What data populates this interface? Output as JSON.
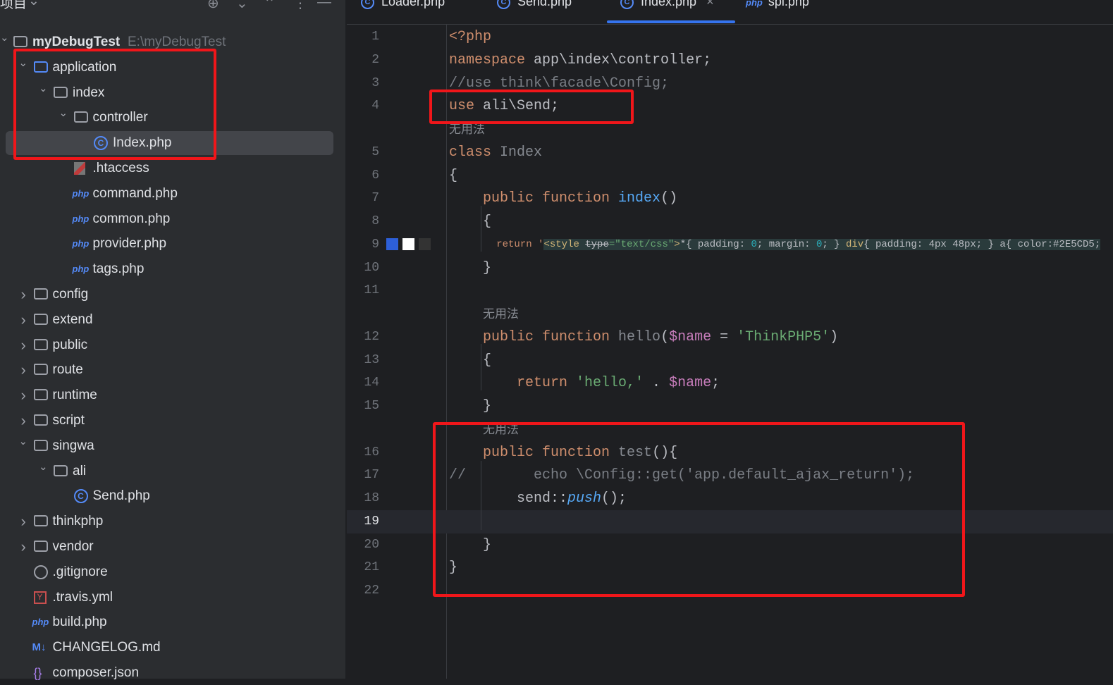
{
  "sidebar": {
    "title": "项目",
    "tree": [
      {
        "label": "myDebugTest",
        "path": "E:\\myDebugTest",
        "icon": "folder",
        "depth": 0,
        "expanded": true,
        "bold": true
      },
      {
        "label": "application",
        "icon": "folder-blue",
        "depth": 1,
        "expanded": true
      },
      {
        "label": "index",
        "icon": "folder",
        "depth": 2,
        "expanded": true
      },
      {
        "label": "controller",
        "icon": "folder",
        "depth": 3,
        "expanded": true
      },
      {
        "label": "Index.php",
        "icon": "class",
        "depth": 4,
        "selected": true
      },
      {
        "label": ".htaccess",
        "icon": "htaccess",
        "depth": 3
      },
      {
        "label": "command.php",
        "icon": "php",
        "depth": 3
      },
      {
        "label": "common.php",
        "icon": "php",
        "depth": 3
      },
      {
        "label": "provider.php",
        "icon": "php",
        "depth": 3
      },
      {
        "label": "tags.php",
        "icon": "php",
        "depth": 3
      },
      {
        "label": "config",
        "icon": "folder",
        "depth": 1,
        "expanded": false
      },
      {
        "label": "extend",
        "icon": "folder",
        "depth": 1,
        "expanded": false
      },
      {
        "label": "public",
        "icon": "folder",
        "depth": 1,
        "expanded": false
      },
      {
        "label": "route",
        "icon": "folder",
        "depth": 1,
        "expanded": false
      },
      {
        "label": "runtime",
        "icon": "folder",
        "depth": 1,
        "expanded": false
      },
      {
        "label": "script",
        "icon": "folder",
        "depth": 1,
        "expanded": false
      },
      {
        "label": "singwa",
        "icon": "folder",
        "depth": 1,
        "expanded": true
      },
      {
        "label": "ali",
        "icon": "folder",
        "depth": 2,
        "expanded": true
      },
      {
        "label": "Send.php",
        "icon": "class",
        "depth": 3
      },
      {
        "label": "thinkphp",
        "icon": "folder",
        "depth": 1,
        "expanded": false
      },
      {
        "label": "vendor",
        "icon": "folder",
        "depth": 1,
        "expanded": false
      },
      {
        "label": ".gitignore",
        "icon": "gitignore",
        "depth": 1
      },
      {
        "label": ".travis.yml",
        "icon": "yml",
        "depth": 1
      },
      {
        "label": "build.php",
        "icon": "php",
        "depth": 1
      },
      {
        "label": "CHANGELOG.md",
        "icon": "md",
        "depth": 1
      },
      {
        "label": "composer.json",
        "icon": "json",
        "depth": 1
      }
    ]
  },
  "tabs": [
    {
      "label": "Loader.php",
      "icon": "class"
    },
    {
      "label": "Send.php",
      "icon": "class"
    },
    {
      "label": "Index.php",
      "icon": "class",
      "active": true,
      "close": "×"
    },
    {
      "label": "spl.php",
      "icon": "php"
    }
  ],
  "icons": {
    "php": "php",
    "md": "M↓",
    "yml": "Y",
    "class": "C",
    "json": "{}"
  },
  "editor": {
    "current_line": 19,
    "lines": [
      {
        "n": "1",
        "t": [
          [
            "<?php",
            "k"
          ]
        ]
      },
      {
        "n": "2",
        "t": [
          [
            "namespace ",
            "k"
          ],
          [
            "app\\index\\controller;",
            ""
          ]
        ]
      },
      {
        "n": "3",
        "t": [
          [
            "//use think\\facade\\Config;",
            "c"
          ]
        ]
      },
      {
        "n": "4",
        "t": [
          [
            "use ",
            "k"
          ],
          [
            "ali\\Send;",
            ""
          ]
        ]
      },
      {
        "anno": "无用法",
        "ind": 0
      },
      {
        "n": "5",
        "t": [
          [
            "class ",
            "k"
          ],
          [
            "Index",
            "u"
          ]
        ]
      },
      {
        "n": "6",
        "t": [
          [
            "{",
            ""
          ]
        ]
      },
      {
        "n": "7",
        "t": [
          [
            "    public function ",
            "k"
          ],
          [
            "index",
            "f"
          ],
          [
            "()",
            ""
          ]
        ]
      },
      {
        "n": "8",
        "t": [
          [
            "    {",
            ""
          ]
        ]
      },
      {
        "n": "9",
        "sw": true,
        "t": [
          [
            "        return '",
            "k"
          ],
          [
            "<style ",
            "t hl"
          ],
          [
            "type",
            "st hl"
          ],
          [
            "=\"text/css\"",
            "s hl"
          ],
          [
            ">",
            "t hl"
          ],
          [
            "*",
            "hl"
          ],
          [
            "{ padding: ",
            "hl"
          ],
          [
            "0",
            "n hl"
          ],
          [
            "; margin: ",
            "hl"
          ],
          [
            "0",
            "n hl"
          ],
          [
            "; } ",
            "hl"
          ],
          [
            "div",
            "t hl"
          ],
          [
            "{ padding: 4px 48px; } a{ color:#2E5CD5;",
            "hl"
          ]
        ]
      },
      {
        "n": "10",
        "t": [
          [
            "    }",
            ""
          ]
        ]
      },
      {
        "n": "11",
        "t": []
      },
      {
        "anno": "无用法",
        "ind": 4
      },
      {
        "n": "12",
        "t": [
          [
            "    public function ",
            "k"
          ],
          [
            "hello",
            "u"
          ],
          [
            "(",
            ""
          ],
          [
            "$name",
            "v"
          ],
          [
            " = ",
            ""
          ],
          [
            "'ThinkPHP5'",
            "s"
          ],
          [
            ")",
            ""
          ]
        ]
      },
      {
        "n": "13",
        "t": [
          [
            "    {",
            ""
          ]
        ]
      },
      {
        "n": "14",
        "t": [
          [
            "        return ",
            "k"
          ],
          [
            "'hello,'",
            "s"
          ],
          [
            " . ",
            ""
          ],
          [
            "$name",
            "v"
          ],
          [
            ";",
            ""
          ]
        ]
      },
      {
        "n": "15",
        "t": [
          [
            "    }",
            ""
          ]
        ]
      },
      {
        "anno": "无用法",
        "ind": 4
      },
      {
        "n": "16",
        "t": [
          [
            "    public function ",
            "k"
          ],
          [
            "test",
            "u"
          ],
          [
            "(){",
            ""
          ]
        ]
      },
      {
        "n": "17",
        "t": [
          [
            "//        echo \\Config::get('app.default_ajax_return');",
            "c"
          ]
        ]
      },
      {
        "n": "18",
        "t": [
          [
            "        send::",
            ""
          ],
          [
            "push",
            "i"
          ],
          [
            "();",
            ""
          ]
        ]
      },
      {
        "n": "19",
        "t": []
      },
      {
        "n": "20",
        "t": [
          [
            "    }",
            ""
          ]
        ]
      },
      {
        "n": "21",
        "t": [
          [
            "}",
            ""
          ]
        ]
      },
      {
        "n": "22",
        "t": []
      }
    ]
  }
}
